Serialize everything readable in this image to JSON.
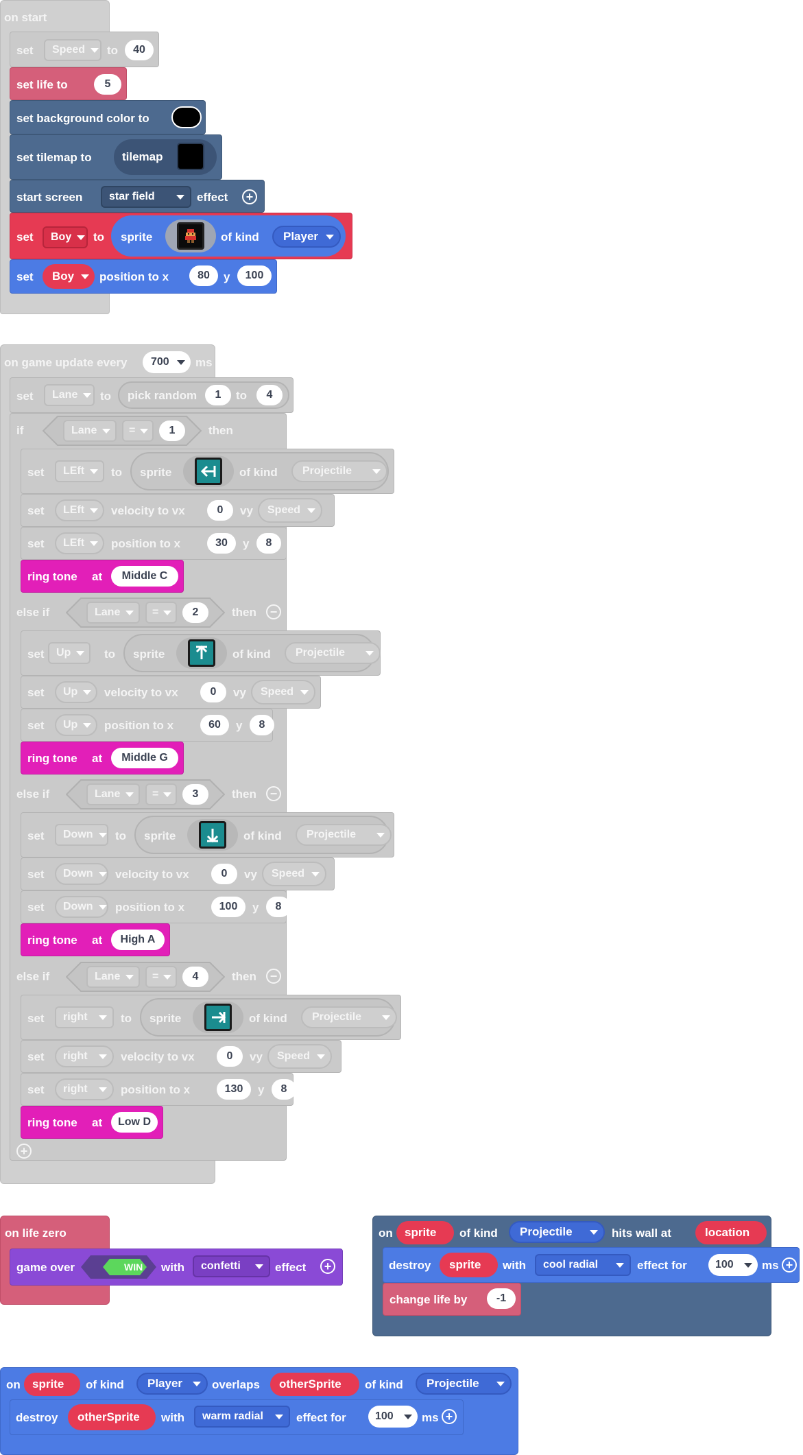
{
  "colors": {
    "disabled_block": "#d0d0d0",
    "variables_red": "#e63a53",
    "info_pink": "#d55f7a",
    "scene_slate": "#4d6a8f",
    "sprites_blue": "#4c7be4",
    "music_magenta": "#e21fb8",
    "effects_purple": "#8a4ad6",
    "logic_green": "#5cd75c"
  },
  "on_start": {
    "header": "on start",
    "set_speed": {
      "set": "set",
      "var": "Speed",
      "to": "to",
      "value": "40"
    },
    "set_life": {
      "label": "set life to",
      "value": "5"
    },
    "set_bg": {
      "label": "set background color to",
      "color": "#000000"
    },
    "set_tilemap": {
      "label": "set tilemap to",
      "tilemap": "tilemap"
    },
    "start_screen": {
      "label": "start screen",
      "effect_name": "star field",
      "effect": "effect"
    },
    "set_boy": {
      "set": "set",
      "var": "Boy",
      "to": "to",
      "sprite": "sprite",
      "of_kind": "of kind",
      "kind": "Player"
    },
    "set_boy_pos": {
      "set": "set",
      "var": "Boy",
      "position": "position to x",
      "x": "80",
      "y_label": "y",
      "y": "100"
    }
  },
  "game_update": {
    "header": "on game update every",
    "interval": "700",
    "unit": "ms",
    "set_lane": {
      "set": "set",
      "var": "Lane",
      "to": "to",
      "pick": "pick random",
      "min": "1",
      "to2": "to",
      "max": "4"
    },
    "branches": [
      {
        "keyword": "if",
        "var": "Lane",
        "op": "=",
        "value": "1",
        "then": "then",
        "sprite_var": "LEft",
        "to": "to",
        "sprite": "sprite",
        "of_kind": "of kind",
        "kind": "Projectile",
        "vel_label": "velocity to vx",
        "vx": "0",
        "vy_label": "vy",
        "vy": "Speed",
        "pos_label": "position to x",
        "x": "30",
        "y_label": "y",
        "y": "8",
        "ring": "ring tone",
        "at": "at",
        "note": "Middle C",
        "arrow": "left"
      },
      {
        "keyword": "else if",
        "var": "Lane",
        "op": "=",
        "value": "2",
        "then": "then",
        "sprite_var": "Up",
        "to": "to",
        "sprite": "sprite",
        "of_kind": "of kind",
        "kind": "Projectile",
        "vel_label": "velocity to vx",
        "vx": "0",
        "vy_label": "vy",
        "vy": "Speed",
        "pos_label": "position to x",
        "x": "60",
        "y_label": "y",
        "y": "8",
        "ring": "ring tone",
        "at": "at",
        "note": "Middle G",
        "arrow": "up"
      },
      {
        "keyword": "else if",
        "var": "Lane",
        "op": "=",
        "value": "3",
        "then": "then",
        "sprite_var": "Down",
        "to": "to",
        "sprite": "sprite",
        "of_kind": "of kind",
        "kind": "Projectile",
        "vel_label": "velocity to vx",
        "vx": "0",
        "vy_label": "vy",
        "vy": "Speed",
        "pos_label": "position to x",
        "x": "100",
        "y_label": "y",
        "y": "8",
        "ring": "ring tone",
        "at": "at",
        "note": "High A",
        "arrow": "down"
      },
      {
        "keyword": "else if",
        "var": "Lane",
        "op": "=",
        "value": "4",
        "then": "then",
        "sprite_var": "right",
        "to": "to",
        "sprite": "sprite",
        "of_kind": "of kind",
        "kind": "Projectile",
        "vel_label": "velocity to vx",
        "vx": "0",
        "vy_label": "vy",
        "vy": "Speed",
        "pos_label": "position to x",
        "x": "130",
        "y_label": "y",
        "y": "8",
        "ring": "ring tone",
        "at": "at",
        "note": "Low D",
        "arrow": "right"
      }
    ]
  },
  "life_zero": {
    "header": "on life zero",
    "game_over": "game over",
    "result": "WIN",
    "with": "with",
    "effect_name": "confetti",
    "effect": "effect"
  },
  "hits_wall": {
    "on": "on",
    "sprite": "sprite",
    "of_kind": "of kind",
    "kind": "Projectile",
    "hits": "hits wall at",
    "location": "location",
    "destroy": "destroy",
    "destroy_target": "sprite",
    "with": "with",
    "effect_name": "cool radial",
    "effect_for": "effect for",
    "duration": "100",
    "unit": "ms",
    "change_life": "change life by",
    "change_value": "-1"
  },
  "overlaps": {
    "on": "on",
    "sprite": "sprite",
    "of_kind": "of kind",
    "kind": "Player",
    "overlaps": "overlaps",
    "other": "otherSprite",
    "of_kind2": "of kind",
    "kind2": "Projectile",
    "destroy": "destroy",
    "destroy_target": "otherSprite",
    "with": "with",
    "effect_name": "warm radial",
    "effect_for": "effect for",
    "duration": "100",
    "unit": "ms"
  }
}
